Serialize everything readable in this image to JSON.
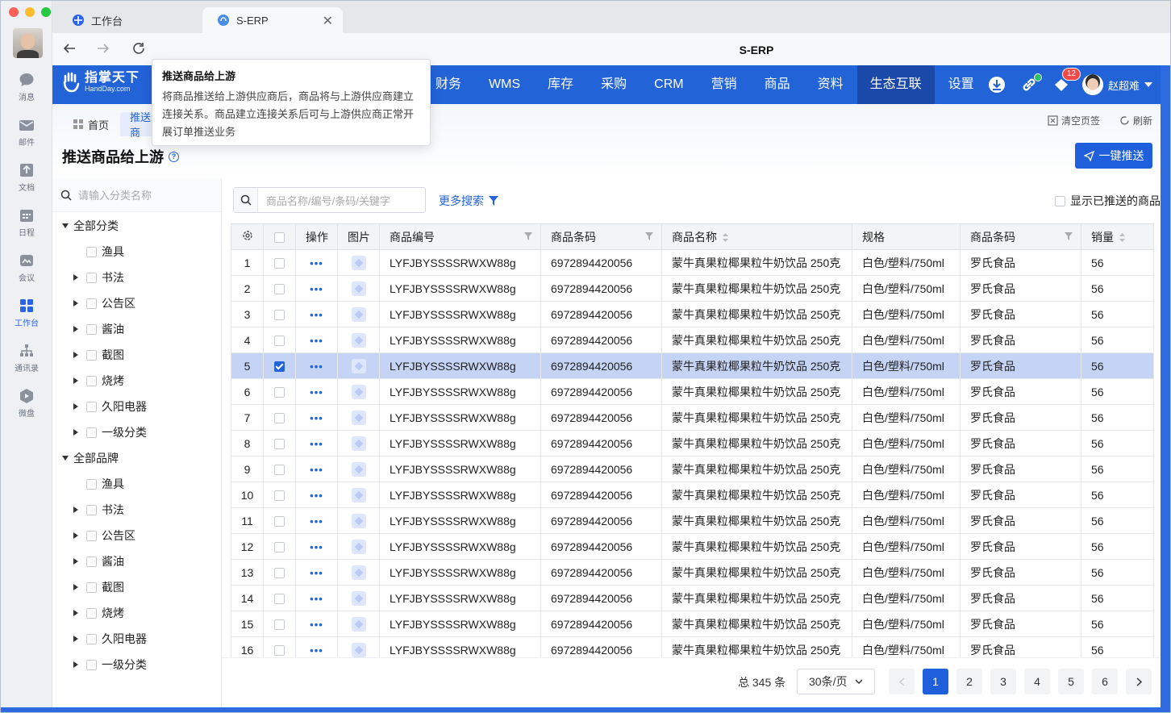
{
  "browser": {
    "tabs": [
      {
        "label": "工作台"
      },
      {
        "label": "S-ERP"
      }
    ],
    "title": "S-ERP"
  },
  "appbar": {
    "items": [
      {
        "label": "消息",
        "icon": "message-icon"
      },
      {
        "label": "邮件",
        "icon": "mail-icon"
      },
      {
        "label": "文档",
        "icon": "document-icon"
      },
      {
        "label": "日程",
        "icon": "calendar-icon"
      },
      {
        "label": "会议",
        "icon": "meeting-icon"
      },
      {
        "label": "工作台",
        "icon": "workbench-icon"
      },
      {
        "label": "通讯录",
        "icon": "contacts-icon"
      },
      {
        "label": "微盘",
        "icon": "drive-icon"
      }
    ]
  },
  "topbar": {
    "logo_title": "指掌天下",
    "logo_sub": "HandDay.com",
    "menu": [
      "财务",
      "WMS",
      "库存",
      "采购",
      "CRM",
      "营销",
      "商品",
      "资料",
      "生态互联",
      "设置"
    ],
    "active_menu": "生态互联",
    "notification_count": "12",
    "username": "赵超难"
  },
  "page": {
    "tabs": {
      "home": "首页",
      "current": "推送商"
    },
    "title": "推送商品给上游",
    "clear_tabs": "清空页签",
    "refresh": "刷新",
    "push_button": "一键推送"
  },
  "tooltip": {
    "title": "推送商品给上游",
    "body": "将商品推送给上游供应商后，商品将与上游供应商建立连接关系。商品建立连接关系后可与上游供应商正常开展订单推送业务"
  },
  "tree": {
    "search_placeholder": "请输入分类名称",
    "group1": "全部分类",
    "group2": "全部品牌",
    "items": [
      "渔具",
      "书法",
      "公告区",
      "酱油",
      "截图",
      "烧烤",
      "久阳电器",
      "一级分类"
    ]
  },
  "toolbar": {
    "search_placeholder": "商品名称/编号/条码/关键字",
    "more_search": "更多搜索",
    "show_pushed": "显示已推送的商品"
  },
  "table": {
    "headers": [
      "操作",
      "图片",
      "商品编号",
      "商品条码",
      "商品名称",
      "规格",
      "商品条码",
      "销量"
    ],
    "rows": [
      {
        "idx": "1",
        "code": "LYFJBYSSSSRWXW88g",
        "barcode": "6972894420056",
        "name": "蒙牛真果粒椰果粒牛奶饮品 250克",
        "spec": "白色/塑料/750ml",
        "brand": "罗氏食品",
        "sales": "56",
        "checked": false
      },
      {
        "idx": "2",
        "code": "LYFJBYSSSSRWXW88g",
        "barcode": "6972894420056",
        "name": "蒙牛真果粒椰果粒牛奶饮品 250克",
        "spec": "白色/塑料/750ml",
        "brand": "罗氏食品",
        "sales": "56",
        "checked": false
      },
      {
        "idx": "3",
        "code": "LYFJBYSSSSRWXW88g",
        "barcode": "6972894420056",
        "name": "蒙牛真果粒椰果粒牛奶饮品 250克",
        "spec": "白色/塑料/750ml",
        "brand": "罗氏食品",
        "sales": "56",
        "checked": false
      },
      {
        "idx": "4",
        "code": "LYFJBYSSSSRWXW88g",
        "barcode": "6972894420056",
        "name": "蒙牛真果粒椰果粒牛奶饮品 250克",
        "spec": "白色/塑料/750ml",
        "brand": "罗氏食品",
        "sales": "56",
        "checked": false
      },
      {
        "idx": "5",
        "code": "LYFJBYSSSSRWXW88g",
        "barcode": "6972894420056",
        "name": "蒙牛真果粒椰果粒牛奶饮品 250克",
        "spec": "白色/塑料/750ml",
        "brand": "罗氏食品",
        "sales": "56",
        "checked": true
      },
      {
        "idx": "6",
        "code": "LYFJBYSSSSRWXW88g",
        "barcode": "6972894420056",
        "name": "蒙牛真果粒椰果粒牛奶饮品 250克",
        "spec": "白色/塑料/750ml",
        "brand": "罗氏食品",
        "sales": "56",
        "checked": false
      },
      {
        "idx": "7",
        "code": "LYFJBYSSSSRWXW88g",
        "barcode": "6972894420056",
        "name": "蒙牛真果粒椰果粒牛奶饮品 250克",
        "spec": "白色/塑料/750ml",
        "brand": "罗氏食品",
        "sales": "56",
        "checked": false
      },
      {
        "idx": "8",
        "code": "LYFJBYSSSSRWXW88g",
        "barcode": "6972894420056",
        "name": "蒙牛真果粒椰果粒牛奶饮品 250克",
        "spec": "白色/塑料/750ml",
        "brand": "罗氏食品",
        "sales": "56",
        "checked": false
      },
      {
        "idx": "9",
        "code": "LYFJBYSSSSRWXW88g",
        "barcode": "6972894420056",
        "name": "蒙牛真果粒椰果粒牛奶饮品 250克",
        "spec": "白色/塑料/750ml",
        "brand": "罗氏食品",
        "sales": "56",
        "checked": false
      },
      {
        "idx": "10",
        "code": "LYFJBYSSSSRWXW88g",
        "barcode": "6972894420056",
        "name": "蒙牛真果粒椰果粒牛奶饮品 250克",
        "spec": "白色/塑料/750ml",
        "brand": "罗氏食品",
        "sales": "56",
        "checked": false
      },
      {
        "idx": "11",
        "code": "LYFJBYSSSSRWXW88g",
        "barcode": "6972894420056",
        "name": "蒙牛真果粒椰果粒牛奶饮品 250克",
        "spec": "白色/塑料/750ml",
        "brand": "罗氏食品",
        "sales": "56",
        "checked": false
      },
      {
        "idx": "12",
        "code": "LYFJBYSSSSRWXW88g",
        "barcode": "6972894420056",
        "name": "蒙牛真果粒椰果粒牛奶饮品 250克",
        "spec": "白色/塑料/750ml",
        "brand": "罗氏食品",
        "sales": "56",
        "checked": false
      },
      {
        "idx": "13",
        "code": "LYFJBYSSSSRWXW88g",
        "barcode": "6972894420056",
        "name": "蒙牛真果粒椰果粒牛奶饮品 250克",
        "spec": "白色/塑料/750ml",
        "brand": "罗氏食品",
        "sales": "56",
        "checked": false
      },
      {
        "idx": "14",
        "code": "LYFJBYSSSSRWXW88g",
        "barcode": "6972894420056",
        "name": "蒙牛真果粒椰果粒牛奶饮品 250克",
        "spec": "白色/塑料/750ml",
        "brand": "罗氏食品",
        "sales": "56",
        "checked": false
      },
      {
        "idx": "15",
        "code": "LYFJBYSSSSRWXW88g",
        "barcode": "6972894420056",
        "name": "蒙牛真果粒椰果粒牛奶饮品 250克",
        "spec": "白色/塑料/750ml",
        "brand": "罗氏食品",
        "sales": "56",
        "checked": false
      },
      {
        "idx": "16",
        "code": "LYFJBYSSSSRWXW88g",
        "barcode": "6972894420056",
        "name": "蒙牛真果粒椰果粒牛奶饮品 250克",
        "spec": "白色/塑料/750ml",
        "brand": "罗氏食品",
        "sales": "56",
        "checked": false
      }
    ]
  },
  "pager": {
    "total": "总 345 条",
    "page_size": "30条/页",
    "pages": [
      "1",
      "2",
      "3",
      "4",
      "5",
      "6"
    ],
    "current": "1"
  },
  "colors": {
    "brand_blue": "#2363d8",
    "active_menu_bg": "#1b49a9",
    "selected_row": "#c5d3f5",
    "badge_red": "#f24949"
  }
}
